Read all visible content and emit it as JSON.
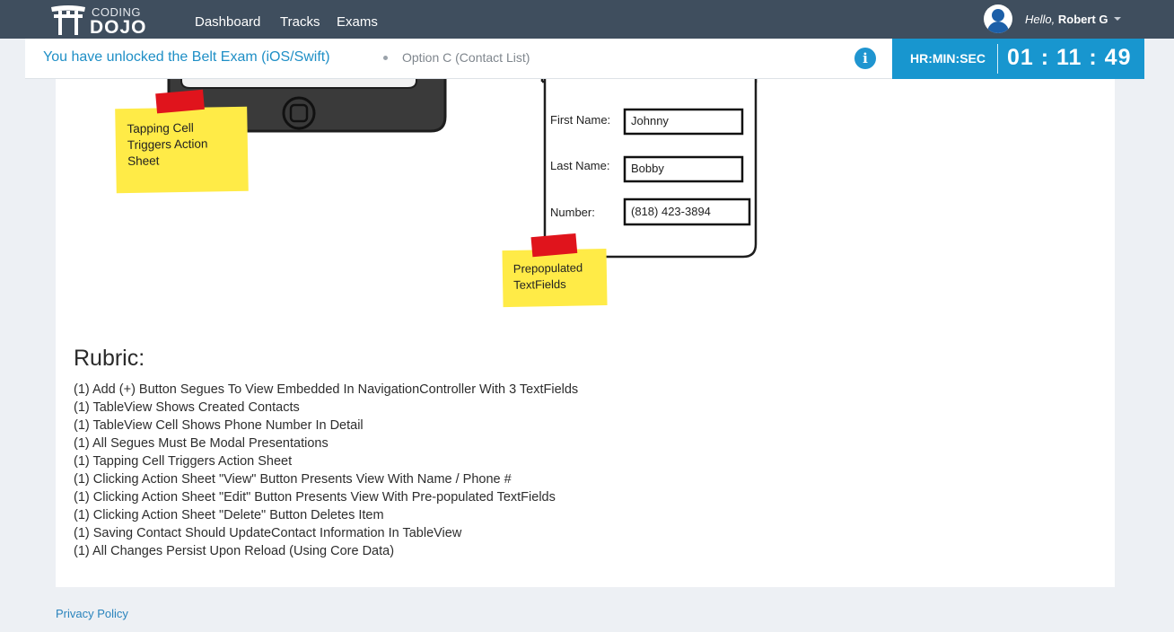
{
  "brand": {
    "top": "CODING",
    "bottom": "DOJO"
  },
  "nav": [
    {
      "label": "Dashboard"
    },
    {
      "label": "Tracks"
    },
    {
      "label": "Exams"
    }
  ],
  "user": {
    "greeting": "Hello,",
    "name": "Robert G"
  },
  "exam": {
    "unlocked_text": "You have unlocked the Belt Exam (iOS/Swift)",
    "option": "Option C (Contact List)",
    "info_glyph": "i",
    "timer_label": "HR:MIN:SEC",
    "timer_value": "01 : 11 : 49"
  },
  "mockup": {
    "note_left": [
      "Tapping Cell",
      "Triggers Action",
      "Sheet"
    ],
    "note_right": [
      "Prepopulated",
      "TextFields"
    ],
    "fields": [
      {
        "label": "First Name:",
        "value": "Johnny"
      },
      {
        "label": "Last Name:",
        "value": "Bobby"
      },
      {
        "label": "Number:",
        "value": "(818) 423-3894"
      }
    ]
  },
  "rubric": {
    "title": "Rubric:",
    "items": [
      "(1) Add (+) Button Segues To View Embedded In NavigationController With 3 TextFields",
      "(1) TableView Shows Created Contacts",
      "(1) TableView Cell Shows Phone Number In Detail",
      "(1) All Segues Must Be Modal Presentations",
      "(1) Tapping Cell Triggers Action Sheet",
      "(1) Clicking Action Sheet \"View\" Button Presents View With Name / Phone #",
      "(1) Clicking Action Sheet \"Edit\" Button Presents View With Pre-populated TextFields",
      "(1) Clicking Action Sheet \"Delete\" Button Deletes Item",
      "(1) Saving Contact Should UpdateContact Information In TableView",
      "(1) All Changes Persist Upon Reload (Using Core Data)"
    ]
  },
  "footer": {
    "privacy": "Privacy Policy"
  },
  "colors": {
    "nav_bg": "#3f4e5e",
    "accent": "#1896cf",
    "link": "#1f8fc6",
    "sticky_note": "#ffeb47",
    "tape": "#e0141c"
  },
  "icons": [
    "torii-gate-icon",
    "avatar-icon",
    "chevron-down-icon",
    "info-icon"
  ]
}
